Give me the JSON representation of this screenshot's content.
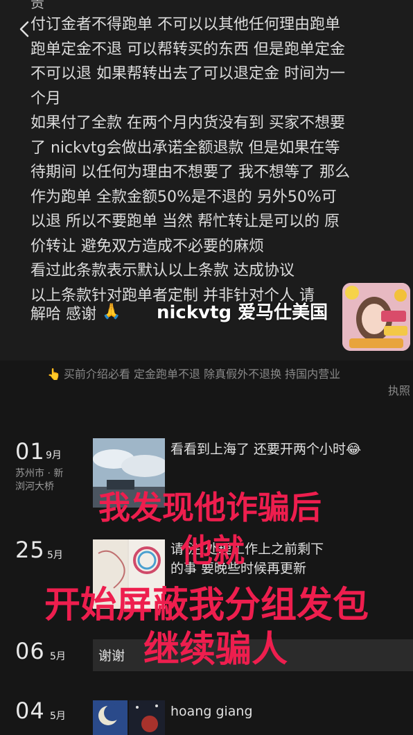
{
  "header": {
    "truncated_text": "责"
  },
  "policy_lines": [
    "付订金者不得跑单 不可以以其他任何理由跑单",
    "跑单定金不退 可以帮转买的东西 但是跑单定金",
    "不可以退 如果帮转出去了可以退定金 时间为一",
    "个月",
    "如果付了全款 在两个月内货没有到 买家不想要",
    "了 nickvtg会做出承诺全额退款 但是如果在等",
    "待期间 以任何为理由不想要了 我不想等了 那么",
    "作为跑单 全款金额50%是不退的 另外50%可",
    "以退 所以不要跑单 当然 帮忙转让是可以的 原",
    "价转让 避免双方造成不必要的麻烦",
    "看过此条款表示默认以上条款 达成协议",
    "以上条款针对跑单者定制 并非针对个人 请"
  ],
  "closing": {
    "thanks": "解哈 感谢",
    "emoji": "🙏"
  },
  "watermark": "nickvtg 爱马仕美国",
  "notice": {
    "line1": "买前介绍必看 定金跑单不退 除真假外不退换 持国内营业",
    "line2": "执照",
    "icon": "👆"
  },
  "posts": [
    {
      "day": "01",
      "month": "9月",
      "location": [
        "苏州市 · 新",
        "浏河大桥"
      ],
      "text": "看看到上海了 还要开两个小时😂"
    },
    {
      "day": "25",
      "month": "5月",
      "location": [],
      "text_lines": [
        "请 注 处理工作上之前剩下",
        "的事 要晚些时候再更新"
      ]
    },
    {
      "day": "06",
      "month": "5月",
      "location": [],
      "text": "谢谢"
    },
    {
      "day": "04",
      "month": "5月",
      "location": [],
      "text": "hoang giang"
    }
  ],
  "overlay_text": [
    "我发现他诈骗后",
    "他就",
    "开始屏蔽我分组发包",
    "继续骗人"
  ],
  "colors": {
    "overlay": "#ee1e4e",
    "background": "#161616"
  }
}
